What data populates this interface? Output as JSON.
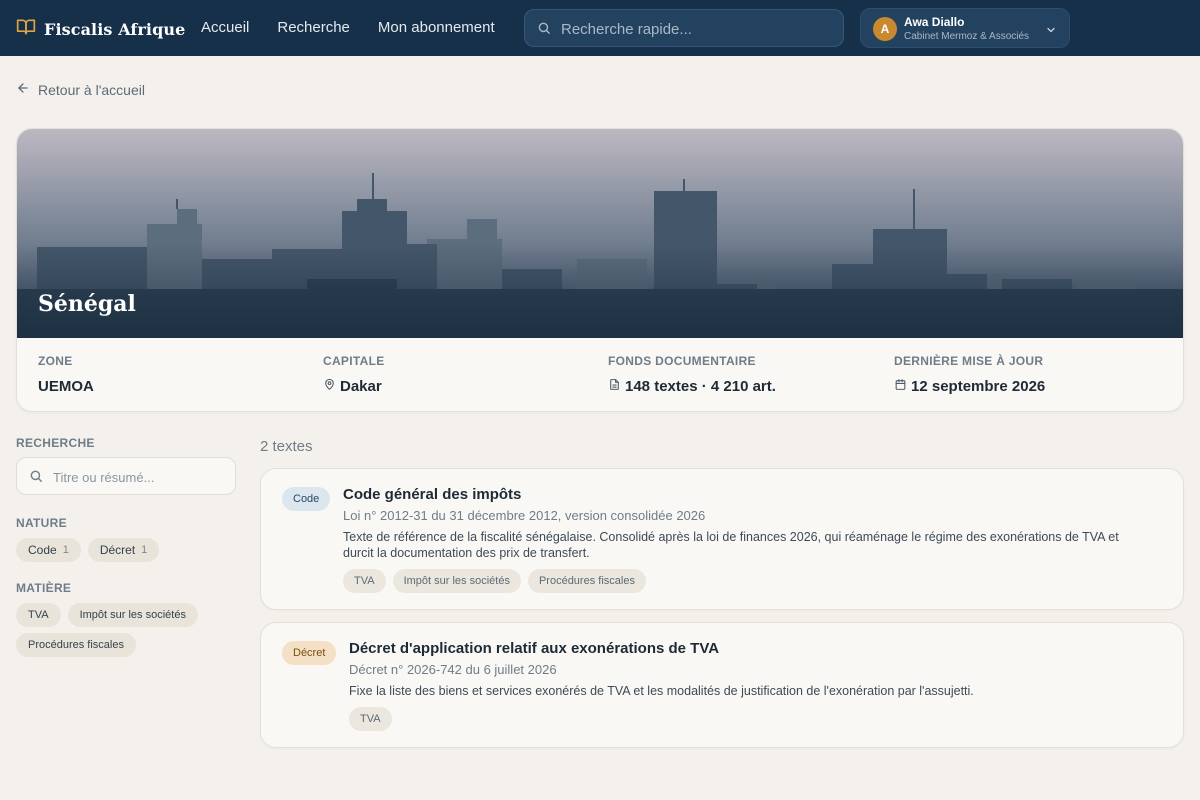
{
  "header": {
    "brand": "Fiscalis Afrique",
    "nav": [
      "Accueil",
      "Recherche",
      "Mon abonnement"
    ],
    "search_placeholder": "Recherche rapide...",
    "user": {
      "initial": "A",
      "name": "Awa Diallo",
      "org": "Cabinet Mermoz & Associés"
    }
  },
  "back_link": "Retour à l'accueil",
  "country": {
    "name": "Sénégal",
    "meta": [
      {
        "label": "ZONE",
        "value": "UEMOA",
        "icon": ""
      },
      {
        "label": "CAPITALE",
        "value": "Dakar",
        "icon": "map-pin-icon"
      },
      {
        "label": "FONDS DOCUMENTAIRE",
        "value": "148 textes · 4 210 art.",
        "icon": "document-icon"
      },
      {
        "label": "DERNIÈRE MISE À JOUR",
        "value": "12 septembre 2026",
        "icon": "calendar-icon"
      }
    ]
  },
  "sidebar": {
    "search_label": "RECHERCHE",
    "search_placeholder": "Titre ou résumé...",
    "nature_label": "NATURE",
    "nature": [
      {
        "label": "Code",
        "count": "1"
      },
      {
        "label": "Décret",
        "count": "1"
      }
    ],
    "matiere_label": "MATIÈRE",
    "matiere": [
      "TVA",
      "Impôt sur les sociétés",
      "Procédures fiscales"
    ]
  },
  "results": {
    "count_text": "2 textes",
    "items": [
      {
        "type": "Code",
        "title": "Code général des impôts",
        "reference": "Loi n° 2012-31 du 31 décembre 2012, version consolidée 2026",
        "summary": "Texte de référence de la fiscalité sénégalaise. Consolidé après la loi de finances 2026, qui réaménage le régime des exonérations de TVA et durcit la documentation des prix de transfert.",
        "tags": [
          "TVA",
          "Impôt sur les sociétés",
          "Procédures fiscales"
        ]
      },
      {
        "type": "Décret",
        "title": "Décret d'application relatif aux exonérations de TVA",
        "reference": "Décret n° 2026-742 du 6 juillet 2026",
        "summary": "Fixe la liste des biens et services exonérés de TVA et les modalités de justification de l'exonération par l'assujetti.",
        "tags": [
          "TVA"
        ]
      }
    ]
  }
}
